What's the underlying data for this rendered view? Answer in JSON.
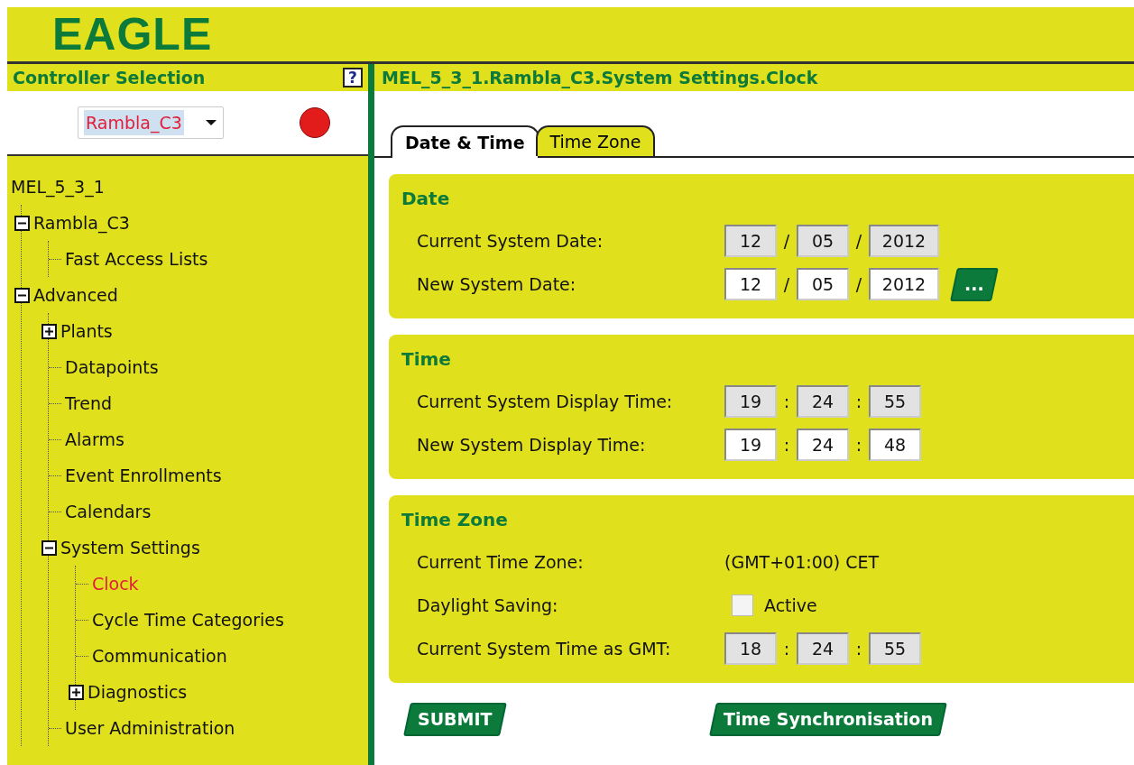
{
  "header": {
    "logo": "EAGLE"
  },
  "sidebar": {
    "title": "Controller Selection",
    "help": "?",
    "controller": {
      "value": "Rambla_C3"
    },
    "tree": [
      {
        "label": "MEL_5_3_1",
        "selected": false,
        "children": [
          {
            "label": "Rambla_C3",
            "selected": false,
            "expanded": true,
            "children": [
              {
                "label": "Fast Access Lists",
                "selected": false
              }
            ]
          },
          {
            "label": "Advanced",
            "selected": false,
            "expanded": true,
            "children": [
              {
                "label": "Plants",
                "selected": false,
                "expanded": false
              },
              {
                "label": "Datapoints",
                "selected": false
              },
              {
                "label": "Trend",
                "selected": false
              },
              {
                "label": "Alarms",
                "selected": false
              },
              {
                "label": "Event Enrollments",
                "selected": false
              },
              {
                "label": "Calendars",
                "selected": false
              },
              {
                "label": "System Settings",
                "selected": false,
                "expanded": true,
                "children": [
                  {
                    "label": "Clock",
                    "selected": true
                  },
                  {
                    "label": "Cycle Time Categories",
                    "selected": false
                  },
                  {
                    "label": "Communication",
                    "selected": false
                  },
                  {
                    "label": "Diagnostics",
                    "selected": false,
                    "expanded": false
                  }
                ]
              },
              {
                "label": "User Administration",
                "selected": false
              }
            ]
          }
        ]
      }
    ]
  },
  "breadcrumb": "MEL_5_3_1.Rambla_C3.System Settings.Clock",
  "tabs": [
    {
      "label": "Date & Time",
      "selected": true
    },
    {
      "label": "Time Zone",
      "selected": false
    }
  ],
  "sections": [
    {
      "title": "Date",
      "rows": [
        {
          "kind": "fields",
          "label": "Current System Date:",
          "readonly": true,
          "separator": "/",
          "values": [
            "12",
            "05",
            "2012"
          ]
        },
        {
          "kind": "fields",
          "label": "New System Date:",
          "readonly": false,
          "separator": "/",
          "values": [
            "12",
            "05",
            "2012"
          ],
          "picker": "..."
        }
      ]
    },
    {
      "title": "Time",
      "rows": [
        {
          "kind": "fields",
          "label": "Current System Display Time:",
          "readonly": true,
          "separator": ":",
          "values": [
            "19",
            "24",
            "55"
          ]
        },
        {
          "kind": "fields",
          "label": "New System Display Time:",
          "readonly": false,
          "separator": ":",
          "values": [
            "19",
            "24",
            "48"
          ]
        }
      ]
    },
    {
      "title": "Time Zone",
      "rows": [
        {
          "kind": "text",
          "label": "Current Time Zone:",
          "value": "(GMT+01:00) CET"
        },
        {
          "kind": "checkbox",
          "label": "Daylight Saving:",
          "checked": false,
          "text": "Active"
        },
        {
          "kind": "fields",
          "label": "Current System Time as GMT:",
          "readonly": true,
          "separator": ":",
          "values": [
            "18",
            "24",
            "55"
          ]
        }
      ]
    }
  ],
  "buttons": [
    "SUBMIT",
    "Time Synchronisation"
  ]
}
